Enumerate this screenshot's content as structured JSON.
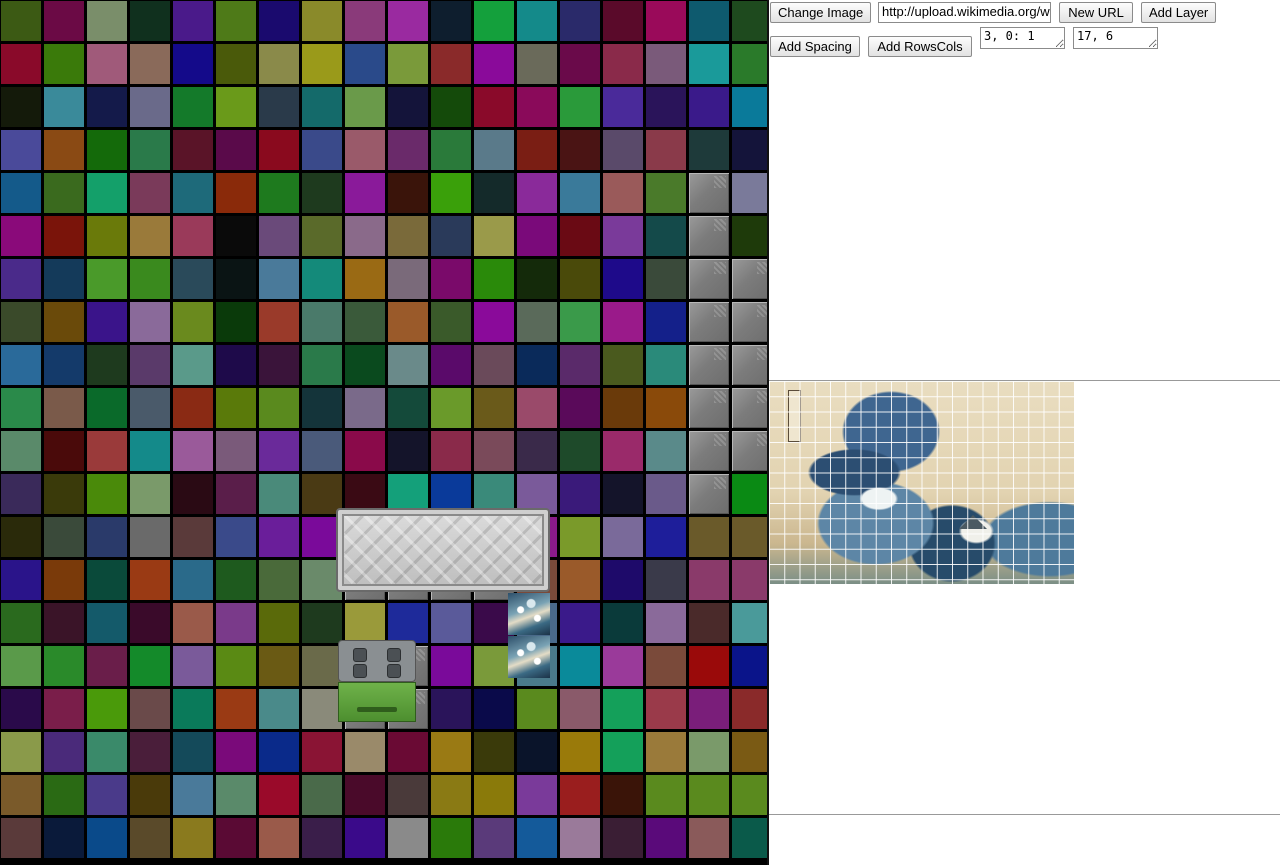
{
  "toolbar": {
    "change_image_label": "Change Image",
    "url_value": "http://upload.wikimedia.org/w",
    "new_url_label": "New URL",
    "add_layer_label": "Add Layer",
    "add_spacing_label": "Add Spacing",
    "add_rowscols_label": "Add RowsCols",
    "spacing_value": "3, 0: 1",
    "rowscols_value": "17, 6"
  },
  "tile_grid": {
    "rows": 20,
    "cols": 18,
    "colors": [
      "#3c5a14",
      "#6b0a45",
      "#7a8e6a",
      "#10301e",
      "#4a1a8a",
      "#4e7a18",
      "#1a0a6e",
      "#8a8a2a",
      "#8a3a7a",
      "#9a2aa0",
      "#0e1e2e",
      "#14a03c",
      "#148a8a",
      "#2a2a6a",
      "#5a0a2a",
      "#9a0a5a",
      "#0e5a6e",
      "#1e4a1e",
      "#8a0a2a",
      "#3a7a0a",
      "#a05a7a",
      "#8a6a5a",
      "#140a8a",
      "#4a5a0a",
      "#8a8a4a",
      "#9a9a1a",
      "#2a4a8a",
      "#7a9a3a",
      "#8a2a2a",
      "#8a0a9a",
      "#6a6a5a",
      "#6a0a4a",
      "#8a2a4a",
      "#7a5a7a",
      "#1a9a9a",
      "#2a7a2a",
      "#141a0a",
      "#3a8a9a",
      "#141a4a",
      "#6a6a8a",
      "#147a2a",
      "#6a9a1a",
      "#2a3a4a",
      "#146a6a",
      "#6a9a4a",
      "#14143a",
      "#144a0a",
      "#8a0a2a",
      "#8a0a5a",
      "#2a9a3a",
      "#4a2a9a",
      "#2a145a",
      "#3a1a8a",
      "#0a7a9a",
      "#4a4a9a",
      "#8a4a14",
      "#146a0a",
      "#2a7a4a",
      "#5a1428",
      "#5a0a4a",
      "#8a0a1e",
      "#3a4a8a",
      "#9a5a6a",
      "#6a2a6a",
      "#2a7a3a",
      "#5a7a8a",
      "#7a1e14",
      "#4a1414",
      "#5a4a6a",
      "#8a3a4a",
      "#1e3a3a",
      "#14143a",
      "#145a8a",
      "#3a6a1e",
      "#14a06a",
      "#7a3a5a",
      "#1e6a7a",
      "#8a2a0a",
      "#1e7a1e",
      "#1e3a1e",
      "#8a1a9a",
      "#3a140a",
      "#3aa00a",
      "#142a2a",
      "#8a2a9a",
      "#3a7a9a",
      "#9a5a5a",
      "#4a7a2a",
      "#7a7a7a",
      "#7a7a9a",
      "#8a0a7a",
      "#7a140a",
      "#6a7a0a",
      "#9a7a3a",
      "#9a3a5a",
      "#0a0a0a",
      "#6a4a7a",
      "#5a6a2a",
      "#8a6a8a",
      "#7a6a3a",
      "#2a3a5a",
      "#9a9a4a",
      "#7a0a7a",
      "#6a0a14",
      "#7a3a9a",
      "#144a4a",
      "#7a7a7a",
      "#1e3a0a",
      "#4a2a8a",
      "#143a5a",
      "#4a9a2a",
      "#3a8a1e",
      "#2a4a5a",
      "#0a1414",
      "#4a7a9a",
      "#148a7a",
      "#9a6a14",
      "#7a6a7a",
      "#7a0a6a",
      "#2a8a0a",
      "#142a0a",
      "#4a4a0a",
      "#1e0a8a",
      "#3a4a3a",
      "#7a7a7a",
      "#7a7a7a",
      "#3a4a2a",
      "#6a4a0a",
      "#3a148a",
      "#8a6a9a",
      "#6a8a1e",
      "#0a3a0a",
      "#9a3a2a",
      "#4a7a6a",
      "#3a5a3a",
      "#9a5a2a",
      "#3a5a2a",
      "#8a0a9a",
      "#5a6a5a",
      "#3a9a4a",
      "#9a1a8a",
      "#14208a",
      "#7a7a7a",
      "#7a7a7a",
      "#2a6a9a",
      "#143a6a",
      "#1e3a1e",
      "#5a3a6a",
      "#5a9a8a",
      "#1e0a4a",
      "#3a143a",
      "#2a7a4a",
      "#0a4a1e",
      "#6a8a8a",
      "#5a0a6a",
      "#6a4a5a",
      "#0a2a5a",
      "#5a2a6a",
      "#4a5a1e",
      "#2a8a7a",
      "#7a7a7a",
      "#7a7a7a",
      "#2a8a4a",
      "#7a5a4a",
      "#0a6a2a",
      "#4a5a6a",
      "#8a2a14",
      "#5a7a0a",
      "#5a8a1e",
      "#14343a",
      "#7a6a8a",
      "#144a3a",
      "#6a9a2a",
      "#6a5a1a",
      "#9a4a6a",
      "#5a0a5a",
      "#6a3a0a",
      "#8a4a0a",
      "#7a7a7a",
      "#7a7a7a",
      "#5a8a6a",
      "#4a0a0a",
      "#9a3a3a",
      "#148a8a",
      "#9a5a9a",
      "#7a5a7a",
      "#6a2a9a",
      "#4a5a7a",
      "#8a0a4a",
      "#14142a",
      "#8a2a4a",
      "#7a4a5a",
      "#3a2a4a",
      "#1e4a2a",
      "#9a2a6a",
      "#5a8a8a",
      "#7a7a7a",
      "#7a7a7a",
      "#3a2a5a",
      "#3a3a0a",
      "#4a8a0a",
      "#7a9a6a",
      "#2a0a14",
      "#5a1e4a",
      "#4a8a7a",
      "#4a3a14",
      "#3a0a14",
      "#14a07a",
      "#0a3a9a",
      "#3a8a7a",
      "#7a5a9a",
      "#3a1a7a",
      "#14142a",
      "#6a5a8a",
      "#7a7a7a",
      "#0a8a14",
      "#2a2a0a",
      "#3a4a3a",
      "#2a3a6a",
      "#6a6a6a",
      "#5a3a3a",
      "#3a4a8a",
      "#6a1e9a",
      "#7a0a9a",
      "#7a7a7a",
      "#7a7a7a",
      "#7a7a7a",
      "#7a7a7a",
      "#8a1a8a",
      "#7a9a2a",
      "#7a6a9a",
      "#1e1e9a",
      "#6a5a2a",
      "#6a5a2a",
      "#2a148a",
      "#7a3a0a",
      "#0a4a3a",
      "#9a3a14",
      "#2a6a8a",
      "#1e5a1e",
      "#4a6a3a",
      "#6a8a6a",
      "#7a7a7a",
      "#7a7a7a",
      "#7a7a7a",
      "#7a7a7a",
      "#7a4a3a",
      "#9a5a2a",
      "#1e0a6a",
      "#3a3a4a",
      "#8a3a6a",
      "#8a3a6a",
      "#2a6a1e",
      "#3a1428",
      "#145a6a",
      "#3a0a2a",
      "#9a5a4a",
      "#7a3a8a",
      "#5a6a0a",
      "#1e3a1e",
      "#9a9a3a",
      "#1e2a9a",
      "#5a5a9a",
      "#3a0a4a",
      "#4a6a8a",
      "#3a1a8a",
      "#0a3a3a",
      "#8a6a9a",
      "#4a2a2a",
      "#4a9a9a",
      "#5a9a4a",
      "#2a8a2a",
      "#6a1e4a",
      "#148a2a",
      "#7a5a9a",
      "#5a8a14",
      "#6a5a14",
      "#6a6a4a",
      "#7a7a7a",
      "#7a7a7a",
      "#7a0a9a",
      "#7a9a3a",
      "#4a7a8a",
      "#0a8a9a",
      "#9a3a9a",
      "#7a4a3a",
      "#9a0a0a",
      "#0a148a",
      "#2a0a4a",
      "#7a1e4a",
      "#4a9a0a",
      "#6a4a4a",
      "#0a7a5a",
      "#9a3a14",
      "#4a8a8a",
      "#8a8a7a",
      "#7a7a7a",
      "#7a7a7a",
      "#2a145a",
      "#0a0a4a",
      "#5a8a1e",
      "#8a5a6a",
      "#14a05a",
      "#9a3a4a",
      "#7a1e7a",
      "#8a2a2a",
      "#8a9a4a",
      "#4a2a7a",
      "#3a8a6a",
      "#4a1e3a",
      "#144a5a",
      "#7a0a7a",
      "#0a2a8a",
      "#8a1434",
      "#9a8a6a",
      "#6a0a34",
      "#9a7a14",
      "#3a3a0a",
      "#0a142a",
      "#9a7a0a",
      "#14a05a",
      "#9a7a3a",
      "#7a9a6a",
      "#7a5a14",
      "#7a5a2a",
      "#2a6a14",
      "#4a3a8a",
      "#4a3a0a",
      "#4a7a9a",
      "#5a8a6a",
      "#9a0a2a",
      "#4a6a4a",
      "#4a0a2a",
      "#4a3a3a",
      "#8a7a14",
      "#8a7a0a",
      "#7a3a9a",
      "#9a1e1e",
      "#3a1408",
      "#5a8a1e",
      "#5a8a1e",
      "#5a8a1e",
      "#5a3a3a",
      "#0a1a3a",
      "#0a4a8a",
      "#5a4a2a",
      "#8a7a1e",
      "#5a0a34",
      "#9a5a4a",
      "#3a1e4a",
      "#3a0a8a",
      "#8a8a8a",
      "#2a7a0a",
      "#5a3a7a",
      "#145a9a",
      "#9a7a9a",
      "#3a1e34",
      "#5a0a7a",
      "#8a5a5a",
      "#0a5a4a"
    ]
  }
}
